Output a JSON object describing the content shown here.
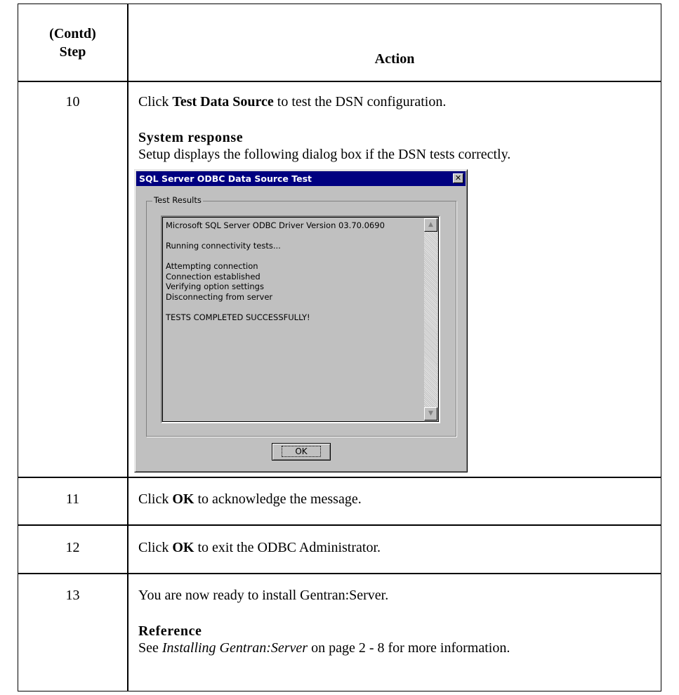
{
  "header": {
    "step_line1": "(Contd)",
    "step_line2": "Step",
    "action": "Action"
  },
  "rows": [
    {
      "step": "10",
      "pre": "Click ",
      "bold": "Test Data Source",
      "post": " to test the DSN configuration.",
      "subheading": "System response",
      "subtext": "Setup displays the following dialog box if the DSN tests correctly."
    },
    {
      "step": "11",
      "pre": "Click ",
      "bold": "OK",
      "post": " to acknowledge the message."
    },
    {
      "step": "12",
      "pre": "Click ",
      "bold": "OK",
      "post": " to exit the ODBC Administrator."
    },
    {
      "step": "13",
      "text": "You are now ready to install Gentran:Server.",
      "subheading": "Reference",
      "ref_pre": "See ",
      "ref_italic": "Installing Gentran:Server",
      "ref_post": " on page 2 - 8 for more information."
    }
  ],
  "dialog": {
    "title": "SQL Server ODBC Data Source Test",
    "close_glyph": "✕",
    "group_label": "Test Results",
    "lines": [
      "Microsoft SQL Server ODBC Driver Version 03.70.0690",
      "",
      "Running connectivity tests...",
      "",
      "Attempting connection",
      "Connection established",
      "Verifying option settings",
      "Disconnecting from server",
      "",
      "TESTS COMPLETED SUCCESSFULLY!"
    ],
    "scroll_up": "▲",
    "scroll_down": "▼",
    "ok_label": "OK"
  }
}
